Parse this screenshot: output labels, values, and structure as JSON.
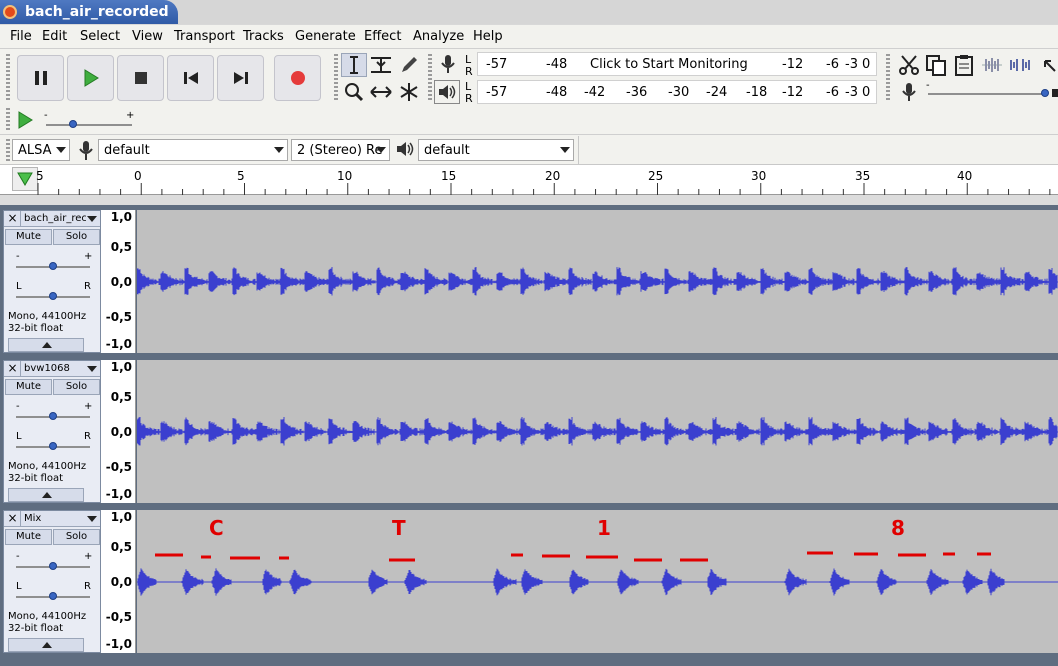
{
  "window": {
    "title": "bach_air_recorded"
  },
  "menu": [
    "File",
    "Edit",
    "Select",
    "View",
    "Transport",
    "Tracks",
    "Generate",
    "Effect",
    "Analyze",
    "Help"
  ],
  "meters": {
    "rec_left": "-57",
    "rec_mid": "-48",
    "rec_prompt": "Click to Start Monitoring",
    "rec_r1": "-12",
    "rec_r2": "-6",
    "rec_r3": "-3",
    "rec_r4": "0",
    "play_scale": [
      "-57",
      "-48",
      "-42",
      "-36",
      "-30",
      "-24",
      "-18",
      "-12",
      "-6",
      "-3",
      "0"
    ],
    "L": "L",
    "R": "R"
  },
  "device": {
    "host": "ALSA",
    "rec_device": "default",
    "channels": "2 (Stereo) Re",
    "play_device": "default"
  },
  "ruler": {
    "ticks": [
      "5",
      "0",
      "5",
      "10",
      "15",
      "20",
      "25",
      "30",
      "35",
      "40"
    ]
  },
  "vscale": [
    "1,0",
    "0,5",
    "0,0",
    "-0,5",
    "-1,0"
  ],
  "tracks": [
    {
      "name": "bach_air_rec",
      "mute": "Mute",
      "solo": "Solo",
      "gain_minus": "-",
      "gain_plus": "+",
      "pan_l": "L",
      "pan_r": "R",
      "info1": "Mono, 44100Hz",
      "info2": "32-bit float"
    },
    {
      "name": "bvw1068",
      "mute": "Mute",
      "solo": "Solo",
      "gain_minus": "-",
      "gain_plus": "+",
      "pan_l": "L",
      "pan_r": "R",
      "info1": "Mono, 44100Hz",
      "info2": "32-bit float"
    },
    {
      "name": "Mix",
      "mute": "Mute",
      "solo": "Solo",
      "gain_minus": "-",
      "gain_plus": "+",
      "pan_l": "L",
      "pan_r": "R",
      "info1": "Mono, 44100Hz",
      "info2": "32-bit float"
    }
  ],
  "annotations": [
    "C",
    "T",
    "1",
    "8"
  ],
  "colors": {
    "wave": "#3b3fcf",
    "annotation": "#e00000",
    "title": "#3a66b5"
  }
}
